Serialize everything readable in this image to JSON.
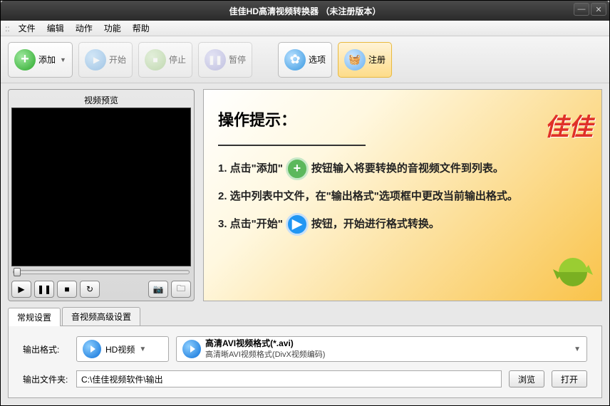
{
  "titlebar": {
    "title": "佳佳HD高清视频转换器    （未注册版本）"
  },
  "menu": {
    "file": "文件",
    "edit": "编辑",
    "action": "动作",
    "function": "功能",
    "help": "帮助"
  },
  "toolbar": {
    "add": "添加",
    "start": "开始",
    "stop": "停止",
    "pause": "暂停",
    "options": "选项",
    "register": "注册"
  },
  "preview": {
    "header": "视频预览"
  },
  "hint": {
    "title": "操作提示：",
    "line1a": "1. 点击\"添加\"",
    "line1b": "按钮输入将要转换的音视频文件到列表。",
    "line2": "2. 选中列表中文件，在\"输出格式\"选项框中更改当前输出格式。",
    "line3a": "3. 点击\"开始\"",
    "line3b": "按钮，开始进行格式转换。",
    "logo": "佳佳"
  },
  "tabs": {
    "general": "常规设置",
    "advanced": "音视频高级设置"
  },
  "settings": {
    "output_format_label": "输出格式:",
    "category": "HD视频",
    "format_title": "高清AVI视频格式(*.avi)",
    "format_desc": "高清晰AVI视频格式(DivX视频编码)",
    "output_folder_label": "输出文件夹:",
    "output_path": "C:\\佳佳视频软件\\输出",
    "browse": "浏览",
    "open": "打开"
  }
}
